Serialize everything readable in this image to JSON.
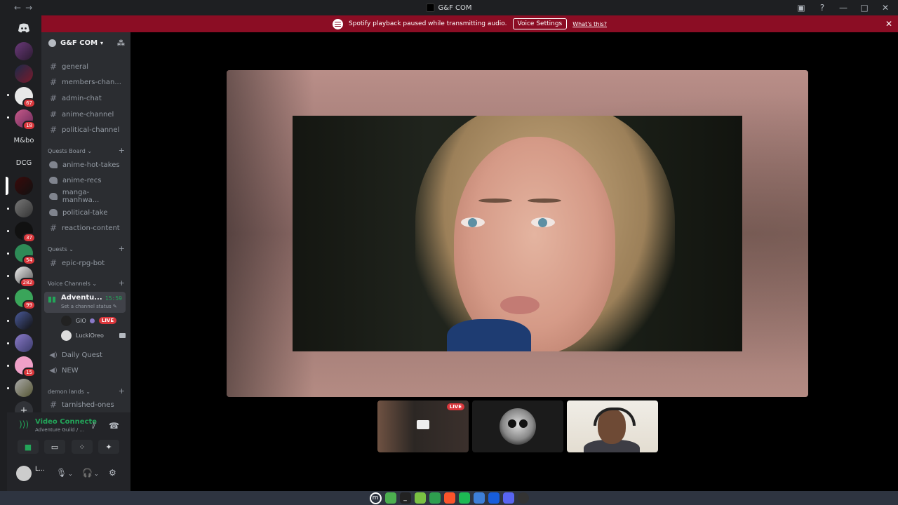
{
  "window": {
    "title": "G&F COM",
    "back": "←",
    "forward": "→"
  },
  "banner": {
    "message": "Spotify playback paused while transmitting audio.",
    "button_label": "Voice Settings",
    "link_label": "What's this?",
    "close": "✕",
    "color": "#8b0d24"
  },
  "servers": {
    "text_items": [
      "M&bo",
      "DCG"
    ],
    "badges": [
      "67",
      "18",
      "37",
      "54",
      "282",
      "99",
      "15"
    ]
  },
  "guild": {
    "name": "G&F COM",
    "channels_top": [
      "general",
      "members-chan...",
      "admin-chat",
      "anime-channel",
      "political-channel"
    ],
    "categories": {
      "quests_board": "Quests Board",
      "quests": "Quests",
      "voice_channels": "Voice Channels",
      "demon_lands": "demon lands"
    },
    "forum_channels": [
      "anime-hot-takes",
      "anime-recs",
      "manga-manhwa...",
      "political-take"
    ],
    "reaction_channel": "reaction-content",
    "quests_channels": [
      "epic-rpg-bot"
    ],
    "voice": {
      "active_name": "Adventu...",
      "active_time": "15:59",
      "status_placeholder": "Set a channel status",
      "users": [
        {
          "name": "GIO",
          "live": "LIVE"
        },
        {
          "name": "LuckiOreo"
        }
      ],
      "other_channels": [
        "Daily Quest",
        "NEW"
      ]
    },
    "demon_lands_channels": [
      "tarnished-ones"
    ]
  },
  "user_panel": {
    "connection_status": "Video Connecte",
    "connection_sub": "Adventure Guild / ...",
    "username": "L...",
    "accent": "#23a559"
  },
  "stage": {
    "thumb_live": "LIVE"
  }
}
